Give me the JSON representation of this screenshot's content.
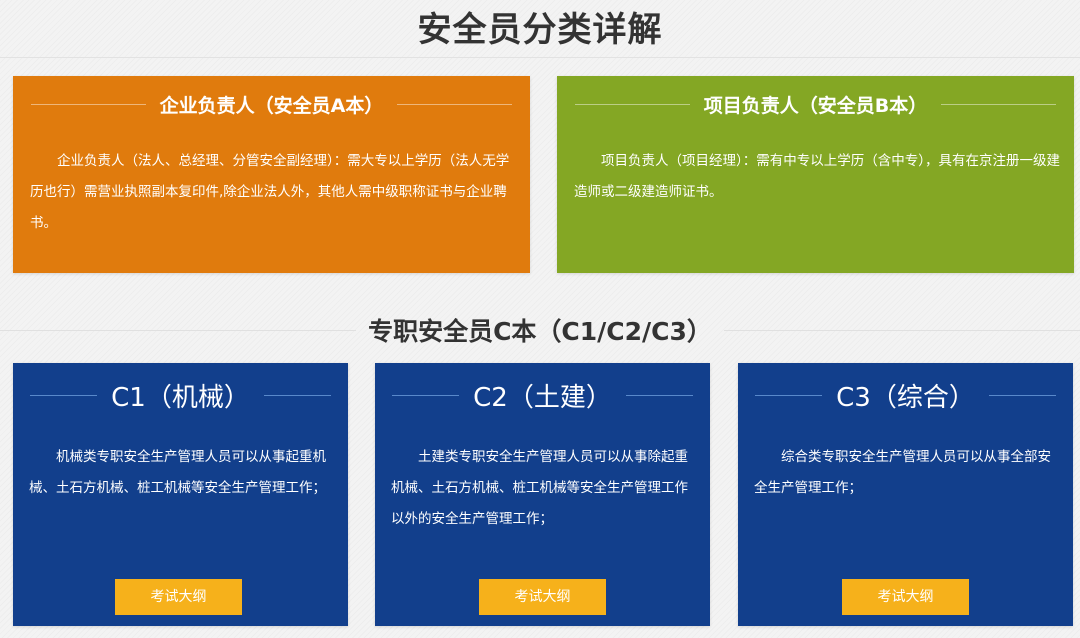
{
  "page": {
    "title": "安全员分类详解",
    "section_c_title": "专职安全员C本（C1/C2/C3）"
  },
  "cards_top": [
    {
      "title": "企业负责人（安全员A本）",
      "body": "企业负责人（法人、总经理、分管安全副经理）：需大专以上学历（法人无学历也行）需营业执照副本复印件,除企业法人外，其他人需中级职称证书与企业聘书。",
      "color": "#e07b0d"
    },
    {
      "title": "项目负责人（安全员B本）",
      "body": "项目负责人（项目经理）：需有中专以上学历（含中专），具有在京注册一级建造师或二级建造师证书。",
      "color": "#84a724"
    }
  ],
  "cards_c": [
    {
      "title": "C1（机械）",
      "body": "机械类专职安全生产管理人员可以从事起重机械、土石方机械、桩工机械等安全生产管理工作；",
      "button": "考试大纲"
    },
    {
      "title": "C2（土建）",
      "body": "土建类专职安全生产管理人员可以从事除起重机械、土石方机械、桩工机械等安全生产管理工作以外的安全生产管理工作；",
      "button": "考试大纲"
    },
    {
      "title": "C3（综合）",
      "body": "综合类专职安全生产管理人员可以从事全部安全生产管理工作；",
      "button": "考试大纲"
    }
  ],
  "colors": {
    "orange": "#e07b0d",
    "green": "#84a724",
    "blue": "#123f8c",
    "button": "#f6b11b"
  }
}
